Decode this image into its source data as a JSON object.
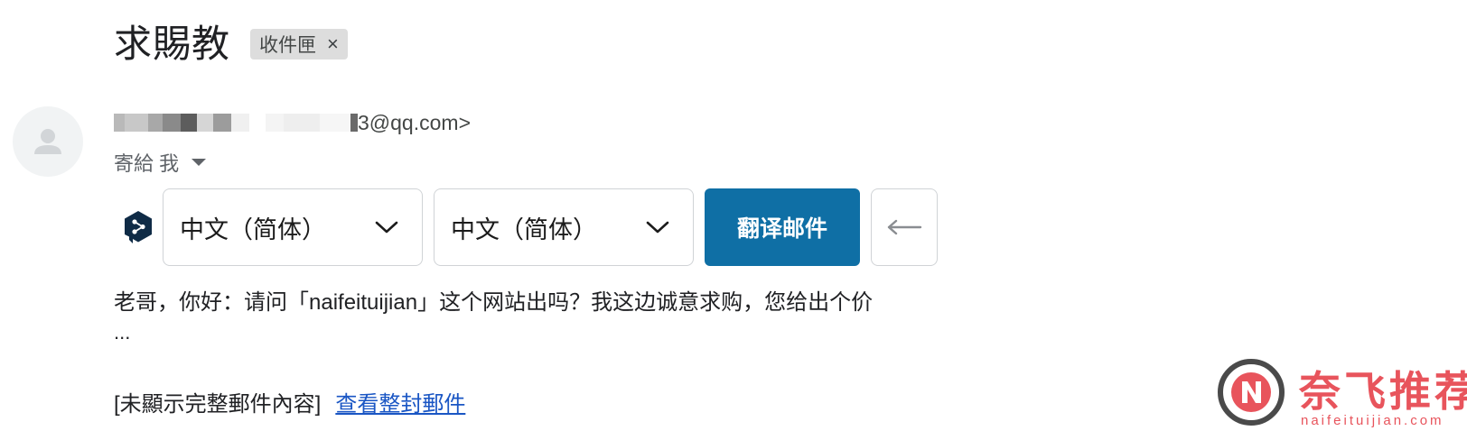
{
  "email": {
    "subject": "求賜教",
    "label": "收件匣",
    "label_remove_icon": "close-icon",
    "sender_email_visible": "3@qq.com>",
    "recipient_line": "寄給 我",
    "body_preview": "老哥，你好：请问「naifeituijian」这个网站出吗？我这边诚意求购，您给出个价",
    "ellipsis": "...",
    "truncated_notice": "[未顯示完整郵件內容]",
    "view_full_link": "查看整封郵件"
  },
  "translator": {
    "logo_icon": "deepl-logo-icon",
    "source_language": "中文（简体）",
    "target_language": "中文（简体）",
    "translate_button": "翻译邮件",
    "back_icon": "arrow-left-icon"
  },
  "watermark": {
    "title": "奈飞推荐",
    "url": "naifeituijian.com"
  },
  "colors": {
    "accent": "#0f6fa5",
    "link": "#1a56c4",
    "watermark": "#e8545c"
  }
}
